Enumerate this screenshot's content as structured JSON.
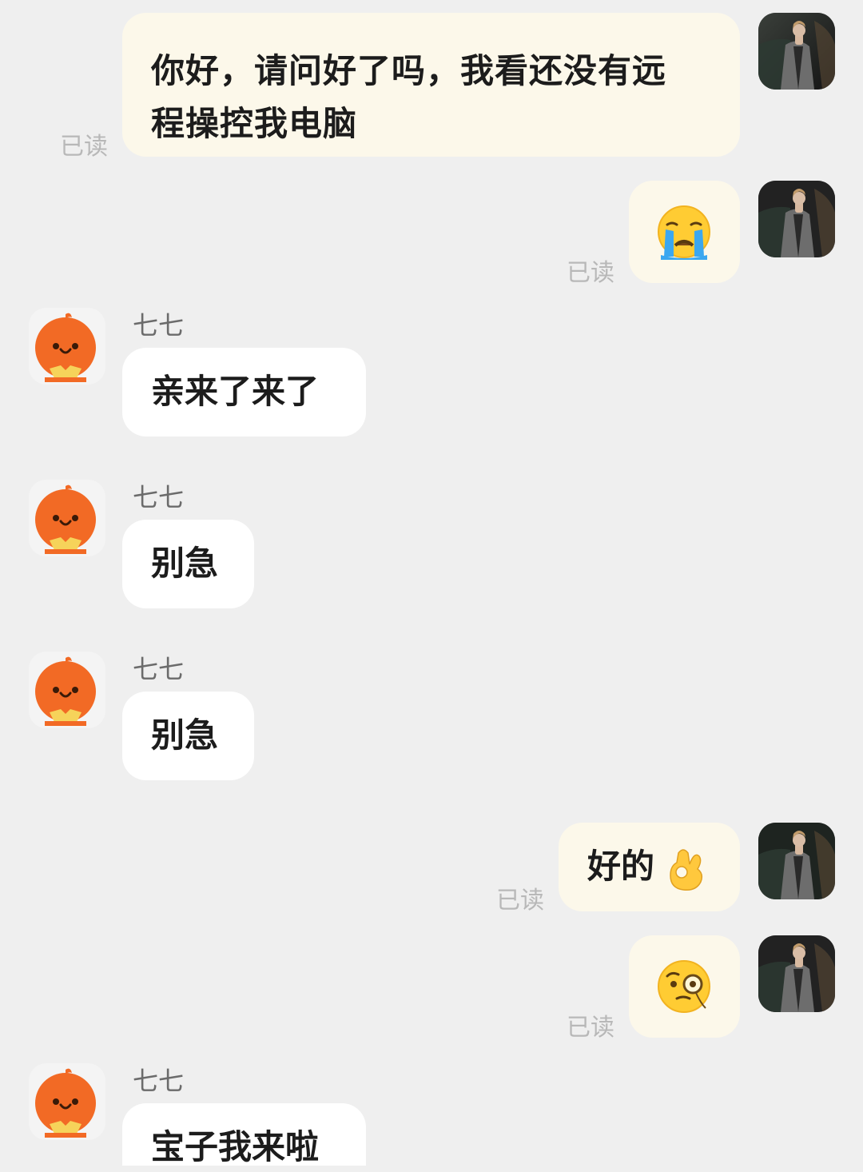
{
  "colors": {
    "background": "#efefef",
    "outgoing_bubble": "#fcf8ea",
    "incoming_bubble": "#ffffff",
    "read_text": "#b8b8b8",
    "name_text": "#6b6b6b",
    "bot_orange": "#f26a25"
  },
  "messages": [
    {
      "side": "outgoing",
      "text_line1": "你好，请问好了吗，我看还没有远",
      "text_line2": "程操控我电脑",
      "read": "已读"
    },
    {
      "side": "outgoing",
      "emoji_icon": "loudly-crying-face-icon",
      "read": "已读"
    },
    {
      "side": "incoming",
      "name": "七七",
      "text": "亲来了来了"
    },
    {
      "side": "incoming",
      "name": "七七",
      "text": "别急"
    },
    {
      "side": "incoming",
      "name": "七七",
      "text": "别急"
    },
    {
      "side": "outgoing",
      "text": "好的",
      "emoji_icon": "ok-hand-icon",
      "read": "已读"
    },
    {
      "side": "outgoing",
      "emoji_icon": "face-with-monocle-icon",
      "read": "已读"
    },
    {
      "side": "incoming",
      "name": "七七",
      "text": "宝子我来啦"
    }
  ]
}
